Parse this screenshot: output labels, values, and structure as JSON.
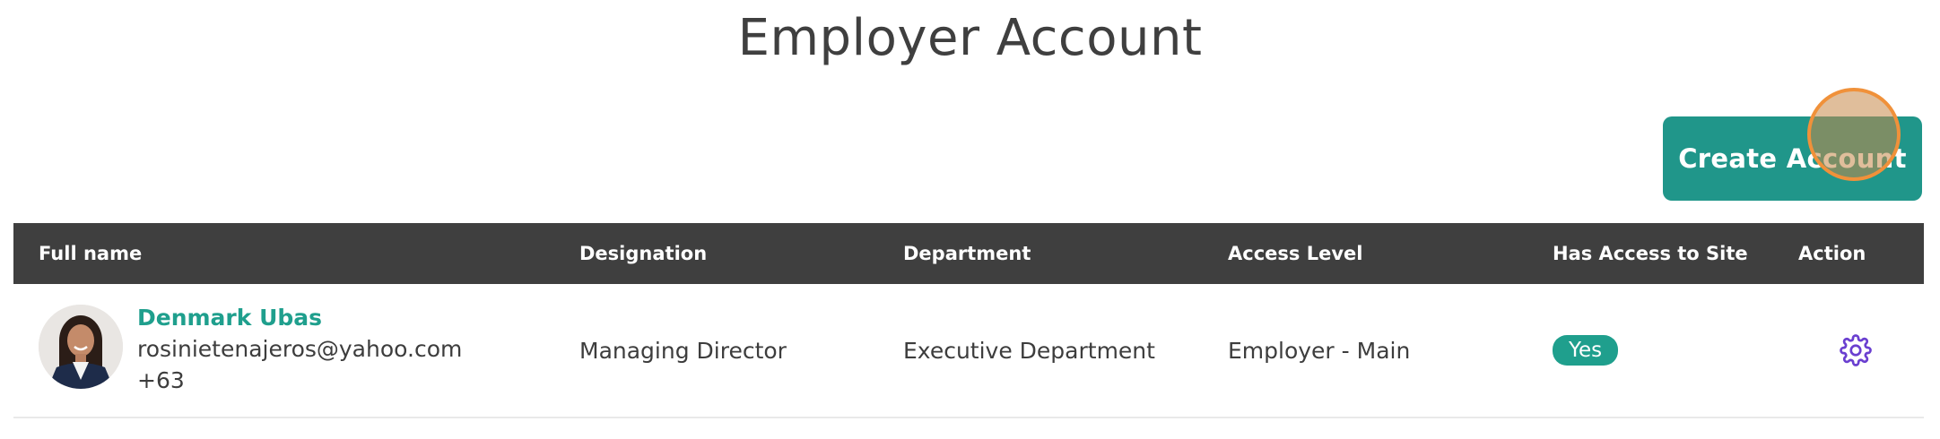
{
  "page": {
    "title": "Employer Account"
  },
  "toolbar": {
    "create_label": "Create Account"
  },
  "table": {
    "headers": {
      "full_name": "Full name",
      "designation": "Designation",
      "department": "Department",
      "access_level": "Access Level",
      "has_access": "Has Access to Site",
      "action": "Action"
    },
    "rows": [
      {
        "name": "Denmark Ubas",
        "email": "rosinietenajeros@yahoo.com",
        "phone": "+63",
        "designation": "Managing Director",
        "department": "Executive Department",
        "access_level": "Employer - Main",
        "has_access": "Yes",
        "action_icon": "gear-icon"
      }
    ]
  },
  "colors": {
    "accent": "#1f9f8d",
    "header_bg": "#3f3f3f",
    "action_icon": "#6a3fd0",
    "cursor_ring": "#f0913a"
  }
}
